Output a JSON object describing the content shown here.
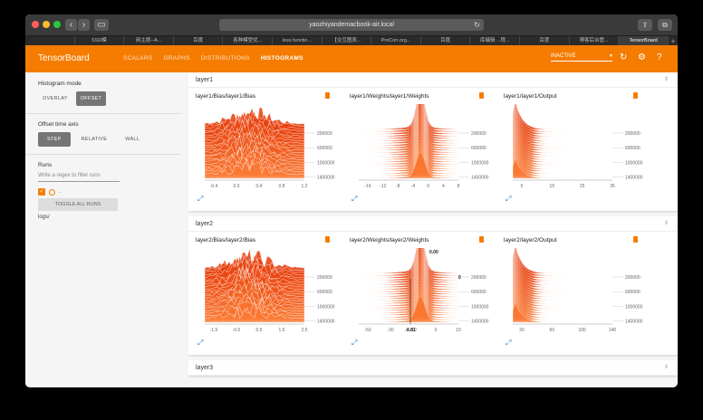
{
  "browser": {
    "address": "yaozhiyandemacbook-air.local",
    "tabs": [
      "",
      "SSD模",
      "网主题--A...",
      "百度",
      "各种模型优...",
      "loss functio...",
      "【交互图表...",
      "ProCon.org...",
      "百度",
      "库编辑 ...程...",
      "百度",
      "博客后台管...",
      "TensorBoard"
    ]
  },
  "header": {
    "logo": "TensorBoard",
    "nav": [
      "SCALARS",
      "GRAPHS",
      "DISTRIBUTIONS",
      "HISTOGRAMS"
    ],
    "status": "INACTIVE"
  },
  "sidebar": {
    "mode_title": "Histogram mode",
    "mode_overlay": "OVERLAY",
    "mode_offset": "OFFSET",
    "axis_title": "Offset time axis",
    "axis_step": "STEP",
    "axis_relative": "RELATIVE",
    "axis_wall": "WALL",
    "runs_title": "Runs",
    "regex_placeholder": "Write a regex to filter runs",
    "run_label": ".",
    "toggle": "TOGGLE ALL RUNS",
    "logs": "logs/"
  },
  "cards": [
    {
      "name": "layer1",
      "plots": [
        {
          "title": "layer1/Bias/layer1/Bias",
          "xticks": [
            "-0.4",
            "0.0",
            "0.4",
            "0.8",
            "1.2"
          ],
          "yticks": [
            "200000",
            "600000",
            "1000000",
            "1400000"
          ]
        },
        {
          "title": "layer1/Weights/layer1/Weights",
          "xticks": [
            "-16",
            "-12",
            "-8",
            "-4",
            "0",
            "4",
            "8"
          ],
          "yticks": [
            "200000",
            "600000",
            "1000000",
            "1400000"
          ]
        },
        {
          "title": "layer1/layer1/Output",
          "xticks": [
            "5",
            "15",
            "25",
            "35"
          ],
          "yticks": [
            "200000",
            "600000",
            "1000000",
            "1400000"
          ]
        }
      ]
    },
    {
      "name": "layer2",
      "plots": [
        {
          "title": "layer2/Bias/layer2/Bias",
          "xticks": [
            "-1.5",
            "-0.5",
            "0.5",
            "1.5",
            "2.5"
          ],
          "yticks": [
            "200000",
            "600000",
            "1000000",
            "1400000"
          ]
        },
        {
          "title": "layer2/Weights/layer2/Weights",
          "xticks": [
            "-50",
            "-30",
            "-10",
            "0",
            "10"
          ],
          "yticks": [
            "200000",
            "600000",
            "1000000",
            "1400000"
          ],
          "hover_top": "0.00",
          "hover_x": "-8.81",
          "hover_right": "0"
        },
        {
          "title": "layer2/layer2/Output",
          "xticks": [
            "20",
            "60",
            "100",
            "140"
          ],
          "yticks": [
            "200000",
            "600000",
            "1000000",
            "1400000"
          ]
        }
      ]
    },
    {
      "name": "layer3",
      "plots": []
    }
  ]
}
